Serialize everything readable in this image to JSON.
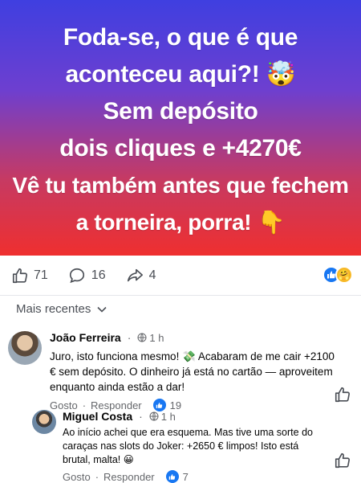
{
  "banner": {
    "lines": [
      "Foda-se, o que é que",
      "aconteceu aqui?! 🤯",
      "Sem depósito",
      "dois cliques e +4270€",
      "Vê tu também antes que fechem",
      "a torneira, porra! 👇"
    ]
  },
  "reactions_bar": {
    "likes": "71",
    "comments": "16",
    "shares": "4",
    "icons": [
      "thumbs-up-icon",
      "comment-bubble-icon",
      "share-arrow-icon"
    ],
    "reaction_emojis": [
      "like-reaction-icon",
      "care-reaction-icon"
    ]
  },
  "sort": {
    "label": "Mais recentes"
  },
  "comments": [
    {
      "author": "João Ferreira",
      "time": "1 h",
      "text": "Juro, isto funciona mesmo! 💸 Acabaram de me cair +2100 € sem depósito. O dinheiro já está no cartão — aproveitem enquanto ainda estão a dar!",
      "like_label": "Gosto",
      "reply_label": "Responder",
      "likes": "19"
    },
    {
      "author": "Miguel Costa",
      "time": "1 h",
      "text": "Ao início achei que era esquema. Mas tive uma sorte do caraças nas slots do Joker: +2650 € limpos! Isto está brutal, malta! 😀",
      "like_label": "Gosto",
      "reply_label": "Responder",
      "likes": "7"
    }
  ],
  "colors": {
    "accent": "#1877f2",
    "banner_top": "#3f3fe0",
    "banner_bottom": "#ef2f2f"
  }
}
